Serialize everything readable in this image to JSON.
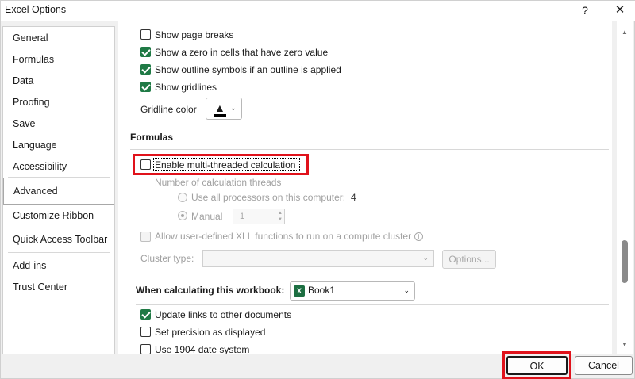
{
  "window": {
    "title": "Excel Options",
    "help_label": "?",
    "close_label": "✕"
  },
  "sidebar": {
    "items": [
      {
        "label": "General"
      },
      {
        "label": "Formulas"
      },
      {
        "label": "Data"
      },
      {
        "label": "Proofing"
      },
      {
        "label": "Save"
      },
      {
        "label": "Language"
      },
      {
        "label": "Accessibility"
      },
      {
        "label": "Advanced"
      },
      {
        "label": "Customize Ribbon"
      },
      {
        "label": "Quick Access Toolbar"
      },
      {
        "label": "Add-ins"
      },
      {
        "label": "Trust Center"
      }
    ],
    "selected": "Advanced"
  },
  "display": {
    "show_page_breaks": {
      "label": "Show page breaks",
      "checked": false
    },
    "show_zero": {
      "label": "Show a zero in cells that have zero value",
      "checked": true
    },
    "show_outline": {
      "label": "Show outline symbols if an outline is applied",
      "checked": true
    },
    "show_gridlines": {
      "label": "Show gridlines",
      "checked": true
    },
    "gridline_color_label": "Gridline color",
    "gridline_color": "#000000"
  },
  "formulas": {
    "heading": "Formulas",
    "multithreaded": {
      "label": "Enable multi-threaded calculation",
      "checked": false
    },
    "threads_label": "Number of calculation threads",
    "use_all_label": "Use all processors on this computer:",
    "processor_count": "4",
    "manual_label": "Manual",
    "manual_value": "1",
    "xll_label": "Allow user-defined XLL functions to run on a compute cluster",
    "cluster_type_label": "Cluster type:",
    "options_button": "Options..."
  },
  "workbook": {
    "heading": "When calculating this workbook:",
    "selected_workbook": "Book1",
    "workbook_icon": "X",
    "update_links": {
      "label": "Update links to other documents",
      "checked": true
    },
    "set_precision": {
      "label": "Set precision as displayed",
      "checked": false
    },
    "use_1904": {
      "label": "Use 1904 date system",
      "checked": false
    }
  },
  "buttons": {
    "ok": "OK",
    "cancel": "Cancel"
  },
  "colors": {
    "highlight": "#e0121b",
    "checkbox_checked": "#1f7a45",
    "excel_green": "#1d6f42"
  }
}
